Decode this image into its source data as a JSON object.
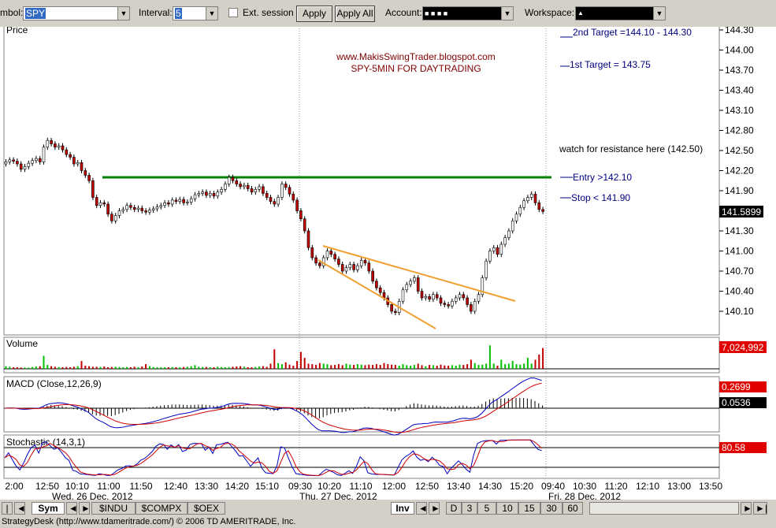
{
  "toolbar": {
    "symbol_label": "mbol:",
    "symbol_value": "SPY",
    "interval_label": "Interval:",
    "interval_value": "5",
    "ext_session_label": "Ext. session",
    "apply_label": "Apply",
    "apply_all_label": "Apply All",
    "account_label": "Account:",
    "account_value": "■   ■   ■   ■",
    "workspace_label": "Workspace:",
    "workspace_value": "▲"
  },
  "panels": {
    "price_title": "Price",
    "volume_title": "Volume",
    "macd_title": "MACD (Close,12,26,9)",
    "stoch_title": "Stochastic (14,3,1)"
  },
  "annotations": {
    "site": "www.MakisSwingTrader.blogspot.com",
    "subtitle": "SPY-5MIN FOR DAYTRADING",
    "target2": "2nd Target =144.10 - 144.30",
    "target1": "1st Target = 143.75",
    "resistance": "watch for resistance here (142.50)",
    "entry": "Entry >142.10",
    "stop": "Stop < 141.90"
  },
  "readouts": {
    "price": "141.5899",
    "volume": "7,024,992",
    "macd_line": "0.2699",
    "macd_hist": "0.0536",
    "stoch": "80.58"
  },
  "bottom_tabs": {
    "left": [
      "Sym",
      "$INDU",
      "$COMPX",
      "$OEX"
    ],
    "inv": "Inv",
    "right": [
      "D",
      "3",
      "5",
      "10",
      "15",
      "30",
      "60"
    ]
  },
  "status_text": "StrategyDesk (http://www.tdameritrade.com/) © 2006 TD AMERITRADE, Inc.",
  "colors": {
    "up": "#00c000",
    "down": "#c00000",
    "entry_line": "#008000",
    "trendline": "#f0a030",
    "annotation_blue": "#000080",
    "annotation_red": "#800000"
  },
  "chart_data": {
    "type": "candlestick",
    "title": "",
    "ylim": [
      139.9,
      144.35
    ],
    "y_ticks": [
      "144.30",
      "144.00",
      "143.70",
      "143.40",
      "143.10",
      "142.80",
      "142.50",
      "142.20",
      "141.90",
      "141.60",
      "141.30",
      "141.00",
      "140.70",
      "140.40",
      "140.10"
    ],
    "x_ticks": [
      "2:00",
      "12:50",
      "10:10",
      "11:00",
      "11:50",
      "12:40",
      "13:30",
      "14:20",
      "15:10",
      "09:30",
      "10:20",
      "11:10",
      "12:00",
      "12:50",
      "13:40",
      "14:30",
      "15:20",
      "09:40",
      "10:30",
      "11:20",
      "12:10",
      "13:00",
      "13:50"
    ],
    "day_labels": [
      "Wed, 26 Dec, 2012",
      "Thu, 27 Dec, 2012",
      "Fri, 28 Dec, 2012"
    ],
    "horizontal_levels": [
      {
        "label": "Entry >142.10",
        "value": 142.1
      }
    ],
    "wedge_lines": [
      {
        "x": [
          40,
          62
        ],
        "y": [
          141.1,
          140.3
        ]
      },
      {
        "x": [
          39,
          54
        ],
        "y": [
          140.82,
          139.85
        ]
      }
    ],
    "close": [
      142.33,
      142.36,
      142.34,
      142.3,
      142.22,
      142.26,
      142.31,
      142.35,
      142.38,
      142.33,
      142.55,
      142.65,
      142.6,
      142.55,
      142.57,
      142.51,
      142.44,
      142.4,
      142.3,
      142.32,
      142.2,
      142.13,
      142.05,
      141.8,
      141.68,
      141.72,
      141.7,
      141.55,
      141.45,
      141.53,
      141.6,
      141.62,
      141.68,
      141.65,
      141.62,
      141.64,
      141.6,
      141.58,
      141.61,
      141.63,
      141.66,
      141.68,
      141.72,
      141.7,
      141.76,
      141.74,
      141.77,
      141.72,
      141.73,
      141.78,
      141.84,
      141.86,
      141.88,
      141.83,
      141.86,
      141.82,
      141.88,
      141.92,
      142.0,
      142.1,
      142.05,
      142.0,
      141.96,
      141.98,
      141.93,
      141.88,
      141.92,
      141.96,
      141.86,
      141.8,
      141.74,
      141.7,
      141.8,
      142.0,
      141.95,
      141.85,
      141.76,
      141.6,
      141.48,
      141.3,
      141.05,
      140.9,
      140.82,
      140.78,
      140.9,
      141.0,
      140.95,
      140.88,
      140.8,
      140.7,
      140.75,
      140.8,
      140.72,
      140.78,
      140.86,
      140.82,
      140.7,
      140.55,
      140.45,
      140.38,
      140.3,
      140.2,
      140.1,
      140.08,
      140.25,
      140.42,
      140.5,
      140.55,
      140.6,
      140.4,
      140.3,
      140.32,
      140.28,
      140.35,
      140.3,
      140.22,
      140.2,
      140.18,
      140.25,
      140.3,
      140.35,
      140.3,
      140.2,
      140.1,
      140.25,
      140.35,
      140.6,
      140.85,
      141.0,
      141.05,
      140.95,
      141.1,
      141.2,
      141.3,
      141.45,
      141.55,
      141.65,
      141.75,
      141.8,
      141.85,
      141.72,
      141.62,
      141.59
    ],
    "volume": [
      0.1,
      0.08,
      0.06,
      0.06,
      0.05,
      0.05,
      0.05,
      0.07,
      0.09,
      0.1,
      0.5,
      0.15,
      0.1,
      0.08,
      0.07,
      0.06,
      0.07,
      0.06,
      0.08,
      0.1,
      0.3,
      0.12,
      0.1,
      0.08,
      0.08,
      0.07,
      0.09,
      0.06,
      0.07,
      0.08,
      0.07,
      0.06,
      0.07,
      0.06,
      0.08,
      0.06,
      0.09,
      0.18,
      0.1,
      0.07,
      0.06,
      0.06,
      0.06,
      0.06,
      0.07,
      0.06,
      0.06,
      0.07,
      0.08,
      0.1,
      0.14,
      0.08,
      0.07,
      0.07,
      0.06,
      0.06,
      0.08,
      0.07,
      0.06,
      0.07,
      0.08,
      0.09,
      0.1,
      0.08,
      0.06,
      0.06,
      0.07,
      0.09,
      0.1,
      0.08,
      0.2,
      0.75,
      0.22,
      0.18,
      0.25,
      0.16,
      0.12,
      0.3,
      0.65,
      0.42,
      0.2,
      0.18,
      0.15,
      0.22,
      0.2,
      0.18,
      0.14,
      0.15,
      0.18,
      0.14,
      0.2,
      0.16,
      0.15,
      0.18,
      0.16,
      0.14,
      0.16,
      0.15,
      0.18,
      0.15,
      0.22,
      0.18,
      0.16,
      0.15,
      0.12,
      0.18,
      0.14,
      0.12,
      0.15,
      0.2,
      0.14,
      0.1,
      0.15,
      0.14,
      0.12,
      0.16,
      0.13,
      0.12,
      0.14,
      0.12,
      0.16,
      0.15,
      0.18,
      0.35,
      0.22,
      0.15,
      0.16,
      0.2,
      0.9,
      0.2,
      0.12,
      0.35,
      0.18,
      0.2,
      0.3,
      0.18,
      0.16,
      0.2,
      0.42,
      0.2,
      0.35,
      0.55,
      0.8
    ]
  }
}
